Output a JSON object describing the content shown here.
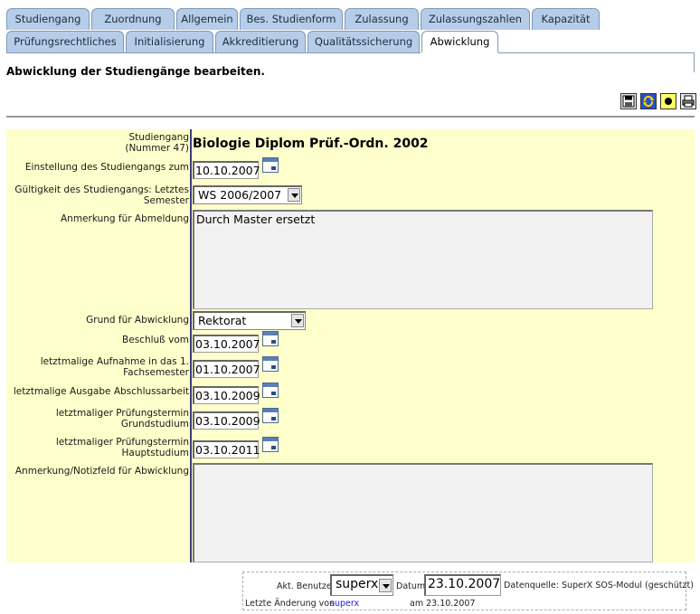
{
  "tabs": {
    "row1": [
      "Studiengang",
      "Zuordnung",
      "Allgemein",
      "Bes. Studienform",
      "Zulassung",
      "Zulassungszahlen",
      "Kapazität"
    ],
    "row2": [
      "Prüfungsrechtliches",
      "Initialisierung",
      "Akkreditierung",
      "Qualitätssicherung",
      "Abwicklung"
    ],
    "active": "Abwicklung"
  },
  "page": {
    "heading": "Abwicklung der Studiengänge bearbeiten."
  },
  "toolbar": {
    "icons": [
      "save-icon",
      "refresh-icon",
      "record-icon",
      "print-icon"
    ]
  },
  "form": {
    "studiengang_label_1": "Studiengang",
    "studiengang_label_2": "(Nummer 47)",
    "studiengang_value": "Biologie Diplom Prüf.-Ordn. 2002",
    "einstellung_label": "Einstellung des Studiengangs zum",
    "einstellung_value": "10.10.2007",
    "gueltigkeit_label_1": "Gültigkeit des Studiengangs: Letztes",
    "gueltigkeit_label_2": "Semester",
    "gueltigkeit_value": "WS 2006/2007",
    "anmerkung_label": "Anmerkung für Abmeldung",
    "anmerkung_value": "Durch Master ersetzt",
    "grund_label": "Grund für Abwicklung",
    "grund_value": "Rektorat",
    "beschluss_label": "Beschluß vom",
    "beschluss_value": "03.10.2007",
    "aufnahme_label_1": "letztmalige Aufnahme in das 1.",
    "aufnahme_label_2": "Fachsemester",
    "aufnahme_value": "01.10.2007",
    "ausgabe_label": "letztmalige Ausgabe Abschlussarbeit",
    "ausgabe_value": "03.10.2009",
    "grundstudium_label_1": "letztmaliger Prüfungstermin",
    "grundstudium_label_2": "Grundstudium",
    "grundstudium_value": "03.10.2009",
    "hauptstudium_label_1": "letztmaliger Prüfungstermin",
    "hauptstudium_label_2": "Hauptstudium",
    "hauptstudium_value": "03.10.2011",
    "notiz_label": "Anmerkung/Notizfeld für Abwicklung",
    "notiz_value": ""
  },
  "footer": {
    "user_label": "Akt. Benutzer",
    "user_value": "superx",
    "date_label": "Datum",
    "date_value": "23.10.2007",
    "source_text": "Datenquelle: SuperX SOS-Modul (geschützt)",
    "last_change_label": "Letzte Änderung von",
    "last_change_user": "superx",
    "last_change_date": "am 23.10.2007"
  },
  "colors": {
    "tab_bg": "#b6cdea",
    "panel_bg": "#ffffcc",
    "divider": "#3d3c7c",
    "link": "#1a1ad0"
  }
}
